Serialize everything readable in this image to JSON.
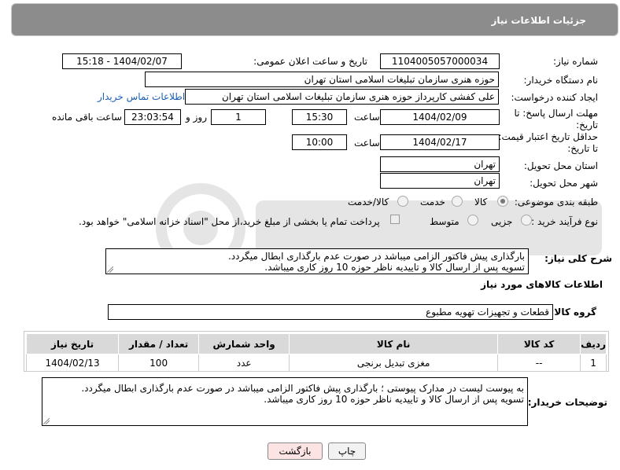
{
  "panel": {
    "title": "جزئیات اطلاعات نیاز"
  },
  "form": {
    "need_number_label": "شماره نیاز:",
    "need_number": "1104005057000034",
    "announce_label": "تاریخ و ساعت اعلان عمومی:",
    "announce_value": "1404/02/07 - 15:18",
    "buyer_org_label": "نام دستگاه خریدار:",
    "buyer_org": "حوزه هنری سازمان تبلیغات اسلامی استان تهران",
    "creator_label": "ایجاد کننده درخواست:",
    "creator": "علی کفشی کارپرداز حوزه هنری سازمان تبلیغات اسلامی استان تهران",
    "contact_link": "اطلاعات تماس خریدار",
    "deadline_label_line1": "مهلت ارسال پاسخ: تا",
    "deadline_label_line2": "تاریخ:",
    "deadline_date": "1404/02/09",
    "time_label": "ساعت",
    "deadline_time": "15:30",
    "days_value": "1",
    "days_label": "روز و",
    "remaining_value": "23:03:54",
    "remaining_label": "ساعت باقی مانده",
    "validity_label_line1": "حداقل تاریخ اعتبار قیمت:",
    "validity_label_line2": "تا تاریخ:",
    "validity_date": "1404/02/17",
    "validity_time_label": "ساعت",
    "validity_time": "10:00",
    "province_label": "استان محل تحویل:",
    "province": "تهران",
    "city_label": "شهر محل تحویل:",
    "city": "تهران",
    "category_label": "طبقه بندی موضوعی:",
    "category_options": [
      "کالا",
      "خدمت",
      "کالا/خدمت"
    ],
    "purchase_type_label": "نوع فرآیند خرید :",
    "purchase_options": [
      "جزیی",
      "متوسط"
    ],
    "payment_note": "پرداخت تمام یا بخشی از مبلغ خرید،از محل \"اسناد خزانه اسلامی\" خواهد بود.",
    "description_label": "شرح کلی نیاز:",
    "description_lines": [
      "بارگذاری پیش فاکتور الزامی میباشد در صورت عدم بارگذاری ابطال میگردد.",
      "تسویه پس از ارسال کالا و تاییدیه ناظر حوزه 10 روز کاری میباشد."
    ]
  },
  "goods": {
    "section_title": "اطلاعات کالاهای مورد نیاز",
    "group_label": "گروه کالا:",
    "group_value": "قطعات و تجهیزات تهویه مطبوع",
    "columns": [
      "ردیف",
      "کد کالا",
      "نام کالا",
      "واحد شمارش",
      "تعداد / مقدار",
      "تاریخ نیاز"
    ],
    "rows": [
      [
        "1",
        "--",
        "مغزی تبدیل برنجی",
        "عدد",
        "100",
        "1404/02/13"
      ]
    ]
  },
  "buyer_notes": {
    "label": "توضیحات خریدار:",
    "lines": [
      "به پیوست لیست در مدارک پیوستی ؛ بارگذاری پیش فاکتور الزامی میباشد در صورت عدم بارگذاری ابطال میگردد.",
      "تسویه پس از ارسال کالا و تاییدیه ناظر حوزه 10 روز کاری میباشد."
    ]
  },
  "buttons": {
    "print": "چاپ",
    "back": "بازگشت"
  },
  "colors": {
    "header": "#8c8c8c",
    "link": "#1a5fb4",
    "back_button": "#fde4e4"
  }
}
